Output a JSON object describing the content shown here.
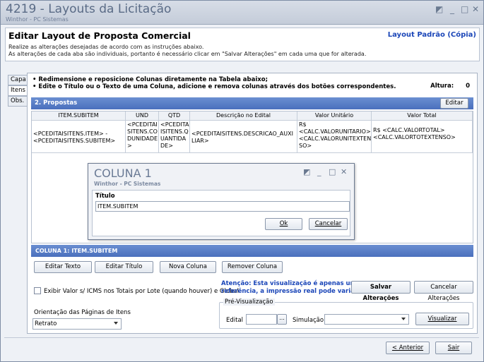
{
  "window": {
    "title": "4219 - Layouts da Licitação",
    "subtitle": "Winthor - PC Sistemas",
    "controls": [
      "◩",
      "_",
      "□",
      "✕"
    ]
  },
  "header": {
    "title": "Editar Layout de Proposta Comercial",
    "layout_name": "Layout Padrão (Cópia)",
    "line1": "Realize as alterações desejadas de acordo com as instruções abaixo.",
    "line2": "As alterações de cada aba são individuais, portanto é necessário clicar em \"Salvar Alterações\" em cada uma que for alterada."
  },
  "tabs": [
    {
      "label": "Capa"
    },
    {
      "label": "Itens"
    },
    {
      "label": "Obs."
    }
  ],
  "instructions": {
    "bullet1": "• Redimensione e reposicione Colunas diretamente na Tabela abaixo;",
    "bullet2": "• Edite o Título ou o Texto de uma Coluna, adicione e remova colunas  através dos botões correspondentes.",
    "altura_label": "Altura:",
    "altura_value": "0"
  },
  "section": {
    "title": "2. Propostas",
    "edit_button": "Editar"
  },
  "grid": {
    "headers": [
      "ITEM.SUBITEM",
      "UND",
      "QTD",
      "Descrição no Edital",
      "Valor Unitário",
      "Valor Total"
    ],
    "row": [
      "<PCEDITAISITENS.ITEM> -\n<PCEDITAISITENS.SUBITEM>",
      "<PCEDITAI\nSITENS.CO\nDUNIDADE\n>",
      "<PCEDITA\nISITENS.Q\nUANTIDA\nDE>",
      "<PCEDITAISITENS.DESCRICAO_AUXI\nLIAR>",
      "R$\n<CALC.VALORUNITARIO>\n<CALC.VALORUNITEXTEN\nSO>",
      "R$ <CALC.VALORTOTAL>\n<CALC.VALORTOTEXTENSO>"
    ]
  },
  "dialog": {
    "title": "COLUNA 1",
    "subtitle": "Winthor - PC Sistemas",
    "field_label": "Título",
    "field_value": "ITEM.SUBITEM",
    "ok_label": "Ok",
    "cancel_label": "Cancelar"
  },
  "column_panel": {
    "title": "COLUNA 1: ITEM.SUBITEM",
    "buttons": [
      "Editar Texto",
      "Editar Título",
      "Nova Coluna",
      "Remover Coluna"
    ]
  },
  "options": {
    "checkbox_label": "Exibir Valor s/ ICMS nos Totais por Lote (quando houver) e Global",
    "warning_line1": "Atenção: Esta visualização é apenas uma",
    "warning_line2": "referência, a impressão real pode variar.",
    "save_button": "Salvar Alterações",
    "cancel_changes_button": "Cancelar Alterações",
    "orientation_label": "Orientação das Páginas de Itens",
    "orientation_value": "Retrato"
  },
  "preview": {
    "legend": "Pré-Visualização",
    "edital_label": "Edital",
    "edital_value": "",
    "edital_button": "...",
    "simulacao_label": "Simulação",
    "simulacao_value": "",
    "visualizar_button": "Visualizar"
  },
  "footer": {
    "anterior_button": "< Anterior",
    "sair_button": "Sair"
  }
}
